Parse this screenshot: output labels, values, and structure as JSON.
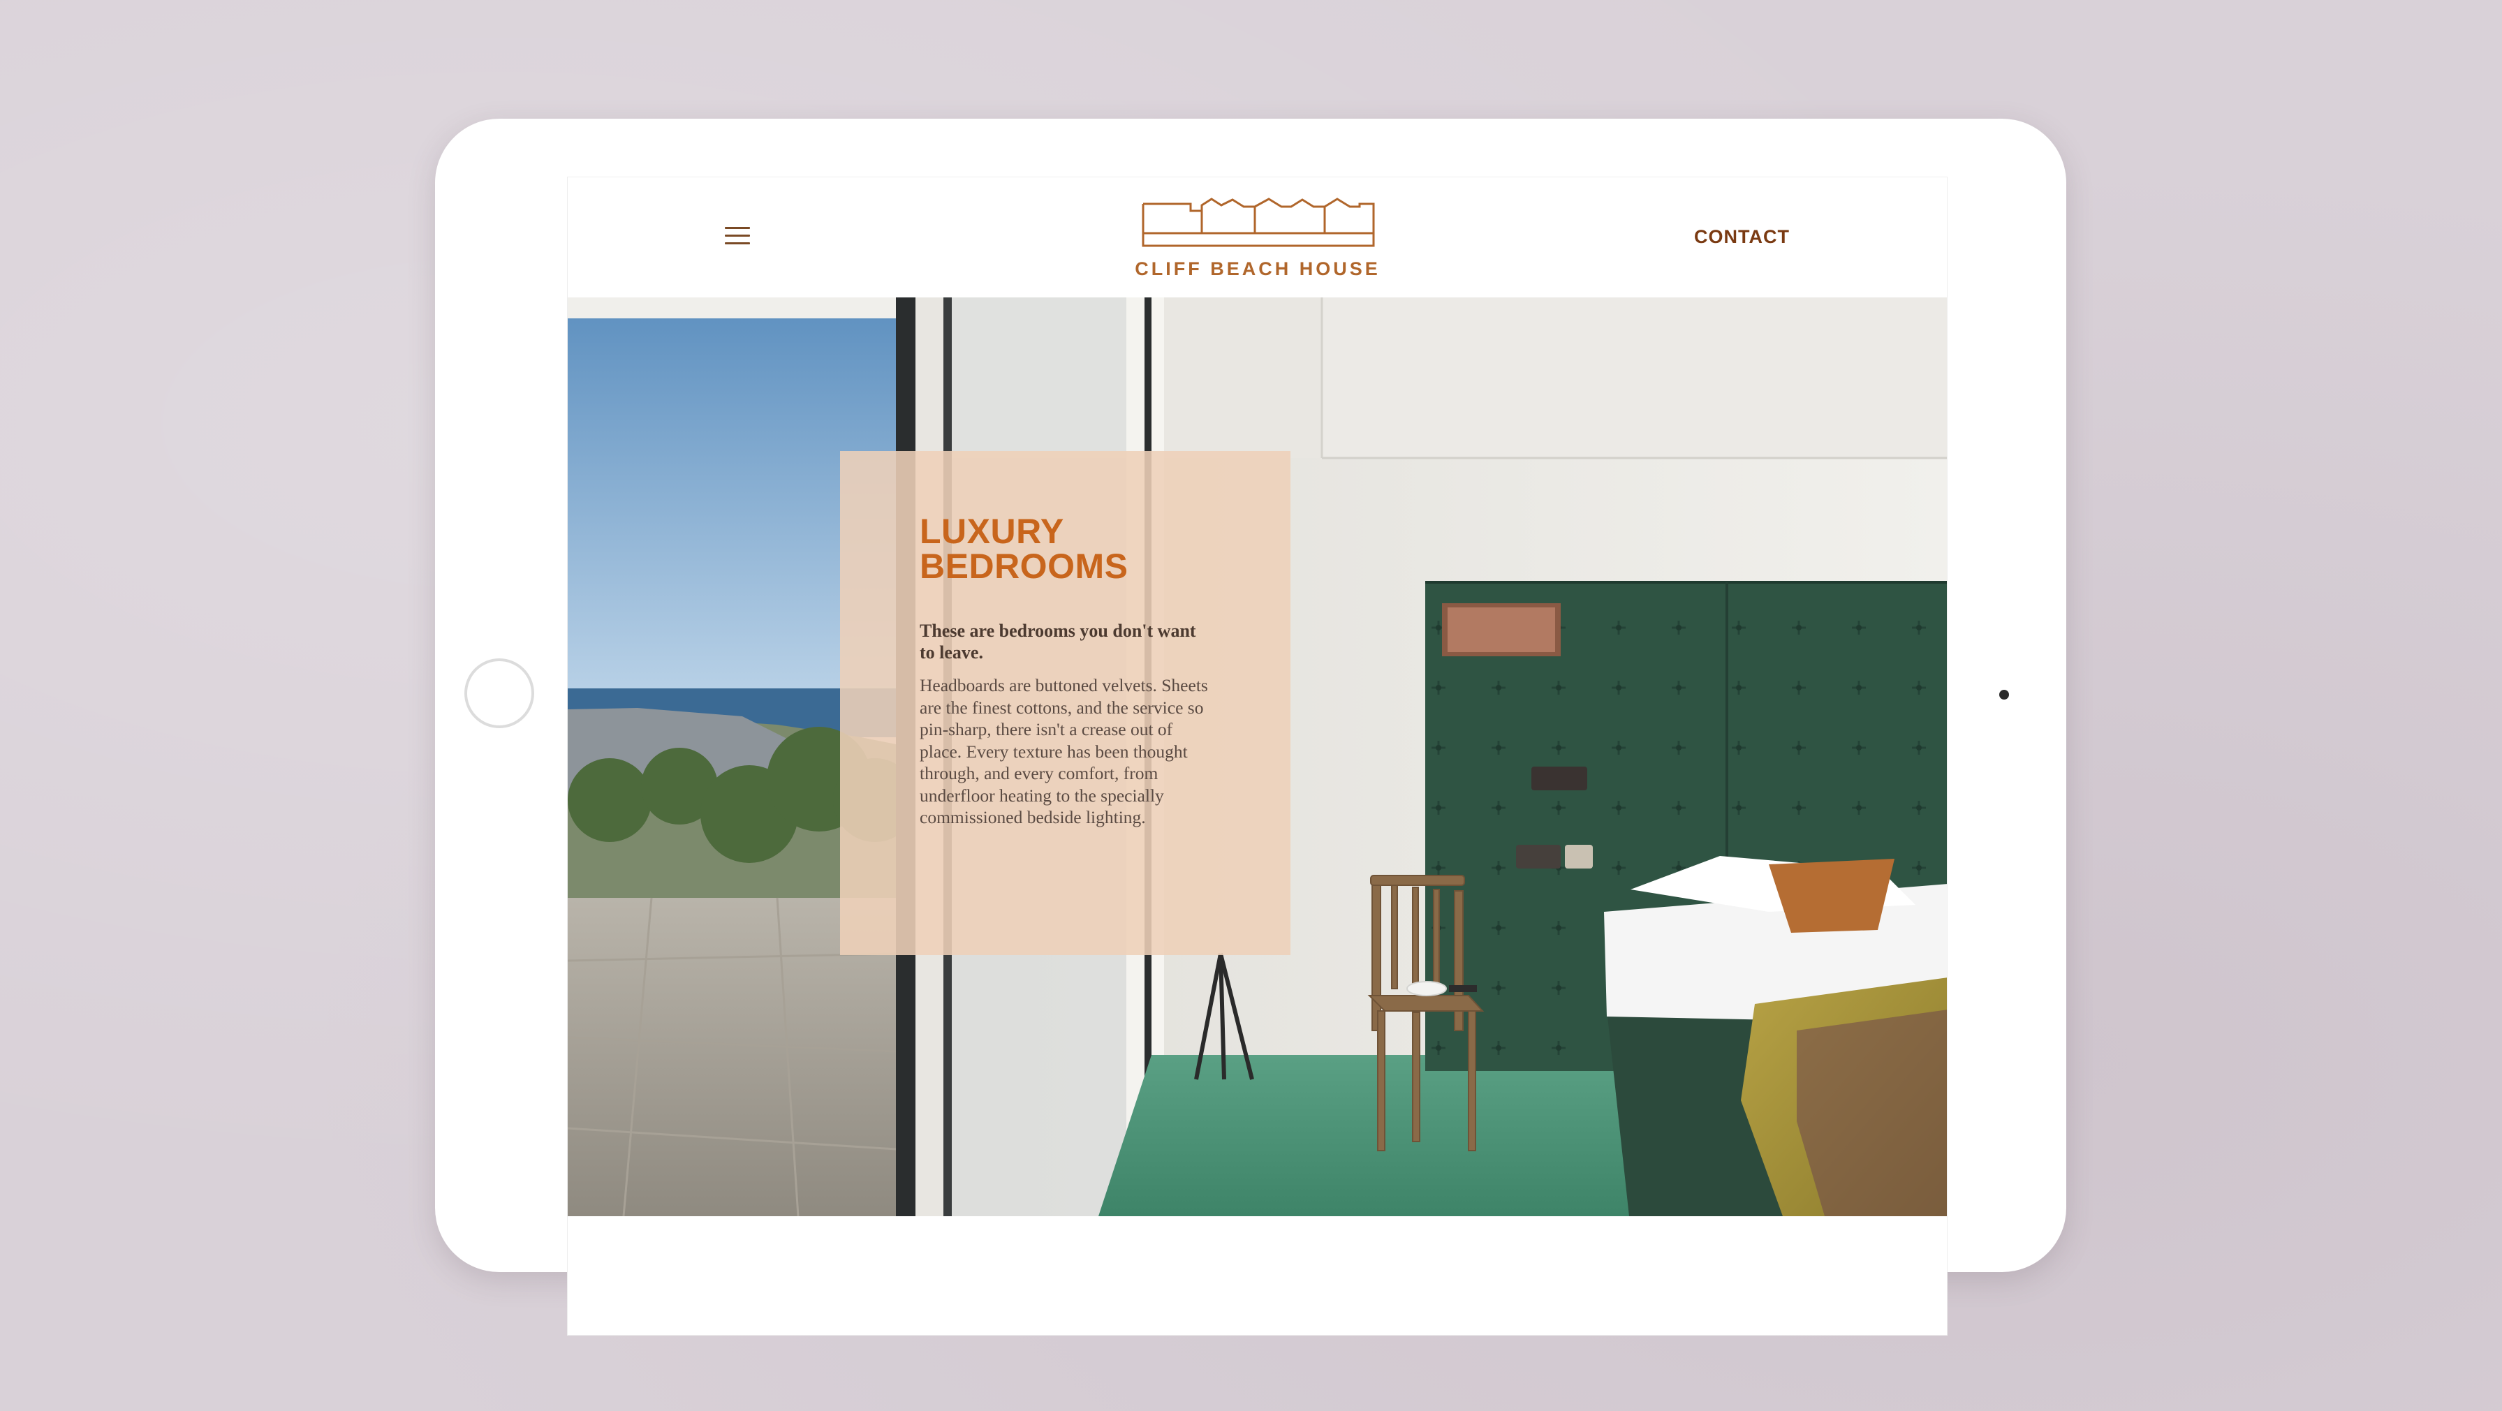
{
  "header": {
    "menu_icon": "hamburger-menu-icon",
    "brand_name": "CLIFF BEACH HOUSE",
    "logo_icon": "house-roofline-logo-icon",
    "contact_label": "CONTACT"
  },
  "hero": {
    "heading": "LUXURY\nBEDROOMS",
    "lead": "These are bedrooms you don't want to leave.",
    "body": "Headboards are buttoned velvets. Sheets are the finest cottons, and the service so pin-sharp, there isn't a crease out of place. Every texture has been thought through, and every comfort, from underfloor heating to the specially commissioned bedside lighting."
  },
  "colors": {
    "background": "#d9d1d8",
    "accent_orange": "#c8651c",
    "brand_brown": "#b0662b",
    "contact_brown": "#7a3a12",
    "card_beige": "#eed0b8",
    "headboard_green": "#2f5443",
    "floor_green": "#4f9478"
  }
}
